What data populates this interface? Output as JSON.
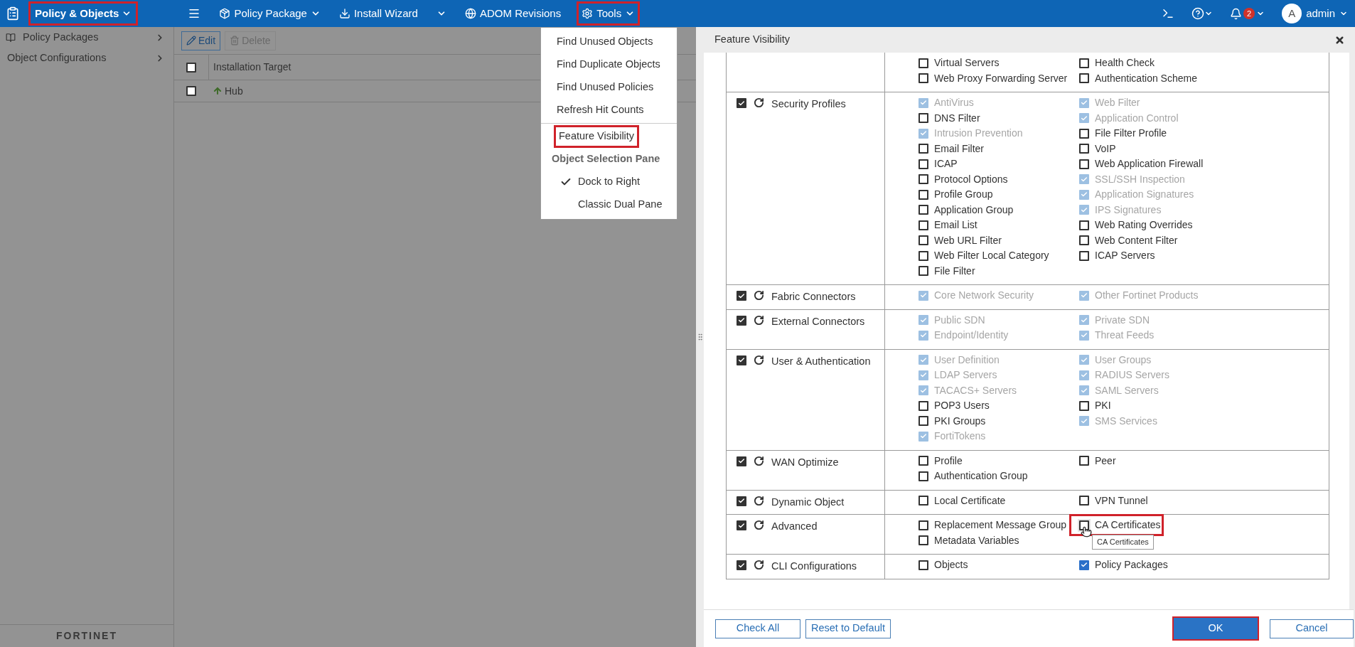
{
  "topbar": {
    "module": {
      "label": "Policy & Objects",
      "highlighted": true
    },
    "menus": [
      {
        "kind": "menu"
      },
      {
        "kind": "dropdown",
        "label": "Policy Package"
      },
      {
        "kind": "plain",
        "label": "Install Wizard"
      },
      {
        "kind": "caret"
      },
      {
        "kind": "plain",
        "label": "ADOM Revisions"
      },
      {
        "kind": "dropdown",
        "label": "Tools",
        "highlighted": true
      }
    ],
    "notifications": "2",
    "avatar": "A",
    "user": "admin"
  },
  "tools_menu": {
    "items": [
      {
        "kind": "item",
        "label": "Find Unused Objects"
      },
      {
        "kind": "item",
        "label": "Find Duplicate Objects"
      },
      {
        "kind": "item",
        "label": "Find Unused Policies"
      },
      {
        "kind": "item",
        "label": "Refresh Hit Counts"
      },
      {
        "kind": "divider"
      },
      {
        "kind": "item",
        "label": "Feature Visibility",
        "highlighted": true
      },
      {
        "kind": "heading",
        "label": "Object Selection Pane"
      },
      {
        "kind": "option",
        "label": "Dock to Right",
        "checked": true
      },
      {
        "kind": "option",
        "label": "Classic Dual Pane",
        "checked": false
      }
    ]
  },
  "sidebar": {
    "items": [
      {
        "label": "Policy Packages"
      },
      {
        "label": "Object Configurations"
      }
    ],
    "logo": "FORTINET"
  },
  "toolbar": {
    "buttons": [
      {
        "label": "Edit",
        "disabled": false
      },
      {
        "label": "Delete",
        "disabled": true
      }
    ]
  },
  "table": {
    "header_checked": false,
    "columns": [
      "Installation Target"
    ],
    "rows": [
      {
        "name": "Hub",
        "checked": false
      }
    ]
  },
  "dialog": {
    "title": "Feature Visibility",
    "rows": [
      {
        "left": [
          {
            "label": "Virtual Servers",
            "checked": false,
            "disabled": false
          },
          {
            "label": "Web Proxy Forwarding Server",
            "checked": false,
            "disabled": false
          }
        ],
        "right": [
          {
            "label": "Health Check",
            "checked": false,
            "disabled": false
          },
          {
            "label": "Authentication Scheme",
            "checked": false,
            "disabled": false
          }
        ]
      },
      {
        "name": "Security Profiles",
        "checked": true,
        "left": [
          {
            "label": "AntiVirus",
            "checked": true,
            "disabled": true
          },
          {
            "label": "DNS Filter",
            "checked": false,
            "disabled": false
          },
          {
            "label": "Intrusion Prevention",
            "checked": true,
            "disabled": true
          },
          {
            "label": "Email Filter",
            "checked": false,
            "disabled": false
          },
          {
            "label": "ICAP",
            "checked": false,
            "disabled": false
          },
          {
            "label": "Protocol Options",
            "checked": false,
            "disabled": false
          },
          {
            "label": "Profile Group",
            "checked": false,
            "disabled": false
          },
          {
            "label": "Application Group",
            "checked": false,
            "disabled": false
          },
          {
            "label": "Email List",
            "checked": false,
            "disabled": false
          },
          {
            "label": "Web URL Filter",
            "checked": false,
            "disabled": false
          },
          {
            "label": "Web Filter Local Category",
            "checked": false,
            "disabled": false
          },
          {
            "label": "File Filter",
            "checked": false,
            "disabled": false
          }
        ],
        "right": [
          {
            "label": "Web Filter",
            "checked": true,
            "disabled": true
          },
          {
            "label": "Application Control",
            "checked": true,
            "disabled": true
          },
          {
            "label": "File Filter Profile",
            "checked": false,
            "disabled": false
          },
          {
            "label": "VoIP",
            "checked": false,
            "disabled": false
          },
          {
            "label": "Web Application Firewall",
            "checked": false,
            "disabled": false
          },
          {
            "label": "SSL/SSH Inspection",
            "checked": true,
            "disabled": true
          },
          {
            "label": "Application Signatures",
            "checked": true,
            "disabled": true
          },
          {
            "label": "IPS Signatures",
            "checked": true,
            "disabled": true
          },
          {
            "label": "Web Rating Overrides",
            "checked": false,
            "disabled": false
          },
          {
            "label": "Web Content Filter",
            "checked": false,
            "disabled": false
          },
          {
            "label": "ICAP Servers",
            "checked": false,
            "disabled": false
          }
        ]
      },
      {
        "name": "Fabric Connectors",
        "checked": true,
        "left": [
          {
            "label": "Core Network Security",
            "checked": true,
            "disabled": true
          }
        ],
        "right": [
          {
            "label": "Other Fortinet Products",
            "checked": true,
            "disabled": true
          }
        ]
      },
      {
        "name": "External Connectors",
        "checked": true,
        "left": [
          {
            "label": "Public SDN",
            "checked": true,
            "disabled": true
          },
          {
            "label": "Endpoint/Identity",
            "checked": true,
            "disabled": true
          }
        ],
        "right": [
          {
            "label": "Private SDN",
            "checked": true,
            "disabled": true
          },
          {
            "label": "Threat Feeds",
            "checked": true,
            "disabled": true
          }
        ]
      },
      {
        "name": "User & Authentication",
        "checked": true,
        "left": [
          {
            "label": "User Definition",
            "checked": true,
            "disabled": true
          },
          {
            "label": "LDAP Servers",
            "checked": true,
            "disabled": true
          },
          {
            "label": "TACACS+ Servers",
            "checked": true,
            "disabled": true
          },
          {
            "label": "POP3 Users",
            "checked": false,
            "disabled": false
          },
          {
            "label": "PKI Groups",
            "checked": false,
            "disabled": false
          },
          {
            "label": "FortiTokens",
            "checked": true,
            "disabled": true
          }
        ],
        "right": [
          {
            "label": "User Groups",
            "checked": true,
            "disabled": true
          },
          {
            "label": "RADIUS Servers",
            "checked": true,
            "disabled": true
          },
          {
            "label": "SAML Servers",
            "checked": true,
            "disabled": true
          },
          {
            "label": "PKI",
            "checked": false,
            "disabled": false
          },
          {
            "label": "SMS Services",
            "checked": true,
            "disabled": true
          }
        ]
      },
      {
        "name": "WAN Optimize",
        "checked": true,
        "left": [
          {
            "label": "Profile",
            "checked": false,
            "disabled": false
          },
          {
            "label": "Authentication Group",
            "checked": false,
            "disabled": false
          }
        ],
        "right": [
          {
            "label": "Peer",
            "checked": false,
            "disabled": false
          }
        ]
      },
      {
        "name": "Dynamic Object",
        "checked": true,
        "left": [
          {
            "label": "Local Certificate",
            "checked": false,
            "disabled": false
          }
        ],
        "right": [
          {
            "label": "VPN Tunnel",
            "checked": false,
            "disabled": false
          }
        ]
      },
      {
        "name": "Advanced",
        "checked": true,
        "left": [
          {
            "label": "Replacement Message Group",
            "checked": false,
            "disabled": false
          },
          {
            "label": "Metadata Variables",
            "checked": false,
            "disabled": false
          }
        ],
        "right": [
          {
            "label": "CA Certificates",
            "checked": false,
            "disabled": false,
            "highlighted": true,
            "tooltip": "CA Certificates"
          }
        ]
      },
      {
        "name": "CLI Configurations",
        "checked": true,
        "left": [
          {
            "label": "Objects",
            "checked": false,
            "disabled": false
          }
        ],
        "right": [
          {
            "label": "Policy Packages",
            "checked": true,
            "disabled": false
          }
        ]
      }
    ],
    "footer_left": [
      "Check All",
      "Reset to Default"
    ],
    "ok": {
      "label": "OK",
      "highlighted": true
    },
    "cancel": "Cancel"
  }
}
